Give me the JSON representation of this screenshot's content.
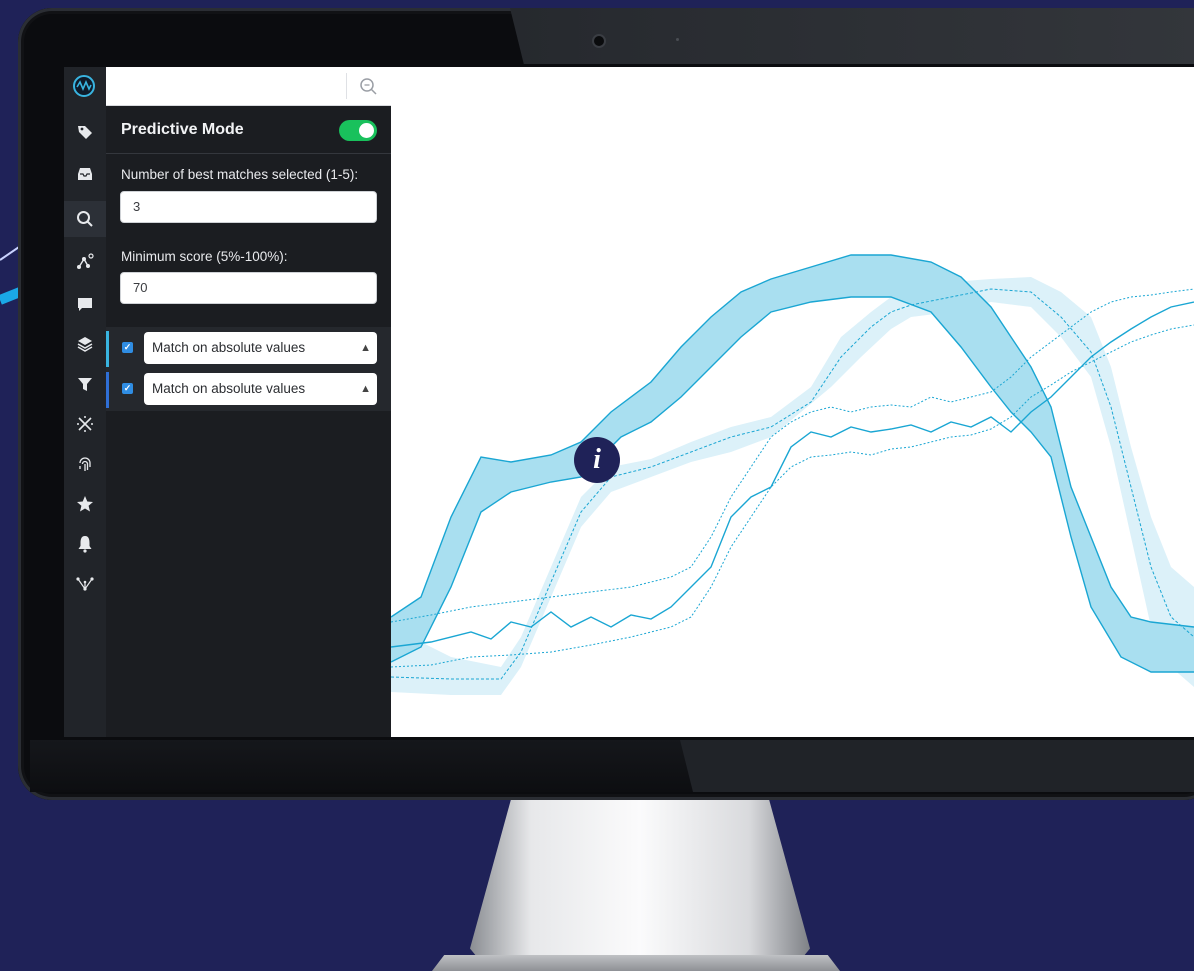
{
  "colors": {
    "background": "#1f2258",
    "accent": "#39b4e0",
    "toggle_on": "#19c15c",
    "checkbox": "#2f8de3",
    "band": "#a9dff0",
    "line": "#1aa6d3"
  },
  "icon_bar": {
    "icons": [
      "logo-icon",
      "tag-icon",
      "inbox-icon",
      "search-icon",
      "graph-nodes-icon",
      "comment-icon",
      "layers-icon",
      "filter-icon",
      "cross-arrows-icon",
      "fingerprint-icon",
      "star-icon",
      "bell-icon",
      "network-icon"
    ]
  },
  "search": {
    "value": "",
    "placeholder": ""
  },
  "predictive_mode": {
    "label": "Predictive Mode",
    "enabled": true
  },
  "best_matches": {
    "label": "Number of best matches selected (1-5):",
    "value": "3"
  },
  "min_score": {
    "label": "Minimum score (5%-100%):",
    "value": "70"
  },
  "match_options": [
    {
      "label": "Match on absolute values",
      "checked": true
    },
    {
      "label": "Match on absolute values",
      "checked": true
    }
  ],
  "info_badge": "i"
}
